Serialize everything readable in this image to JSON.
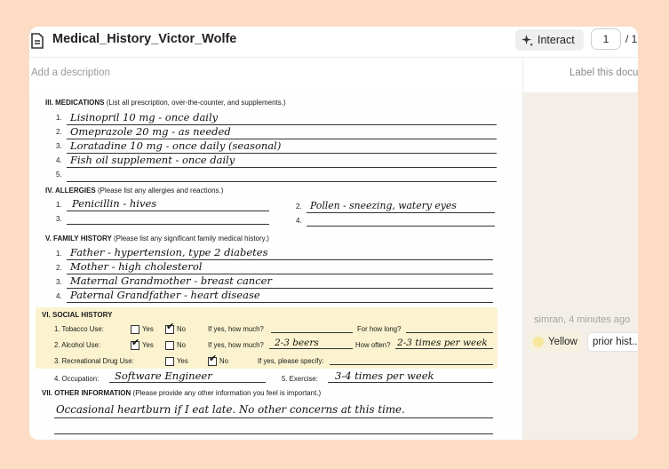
{
  "header": {
    "title": "Medical_History_Victor_Wolfe",
    "interact_label": "Interact",
    "page_current": "1",
    "page_total": "/ 1"
  },
  "description_placeholder": "Add a description",
  "label_placeholder": "Label this docu",
  "comment": {
    "meta": "simran, 4 minutes ago",
    "tag_color": "Yellow",
    "tag_label": "prior hist..."
  },
  "form": {
    "medications": {
      "title": "III. MEDICATIONS",
      "subtitle": "(List all prescription, over-the-counter, and supplements.)",
      "items": [
        "Lisinopril 10 mg - once daily",
        "Omeprazole 20 mg - as needed",
        "Loratadine 10 mg - once daily (seasonal)",
        "Fish oil supplement - once daily",
        ""
      ]
    },
    "allergies": {
      "title": "IV. ALLERGIES",
      "subtitle": "(Please list any allergies and reactions.)",
      "items": [
        "Penicillin - hives",
        "Pollen - sneezing, watery eyes",
        "",
        ""
      ]
    },
    "family": {
      "title": "V. FAMILY HISTORY",
      "subtitle": "(Please list any significant family medical history.)",
      "items": [
        "Father - hypertension, type 2 diabetes",
        "Mother - high cholesterol",
        "Maternal Grandmother - breast cancer",
        "Paternal Grandfather - heart disease"
      ]
    },
    "social": {
      "title": "VI. SOCIAL HISTORY",
      "tobacco_label": "1. Tobacco Use:",
      "alcohol_label": "2. Alcohol Use:",
      "drug_label": "3. Recreational Drug Use:",
      "yes": "Yes",
      "no": "No",
      "how_much": "If yes, how much?",
      "how_long": "For how long?",
      "how_often": "How often?",
      "specify": "If yes, please specify:",
      "alcohol_amount": "2-3 beers",
      "alcohol_often": "2-3 times per week",
      "tobacco": "No",
      "alcohol": "Yes",
      "drugs": "No"
    },
    "occupation_label": "4. Occupation:",
    "occupation_value": "Software Engineer",
    "exercise_label": "5. Exercise:",
    "exercise_value": "3-4 times per week",
    "other": {
      "title": "VII. OTHER INFORMATION",
      "subtitle": "(Please provide any other information you feel is important.)",
      "value": "Occasional heartburn if I eat late. No other concerns at this time."
    }
  }
}
